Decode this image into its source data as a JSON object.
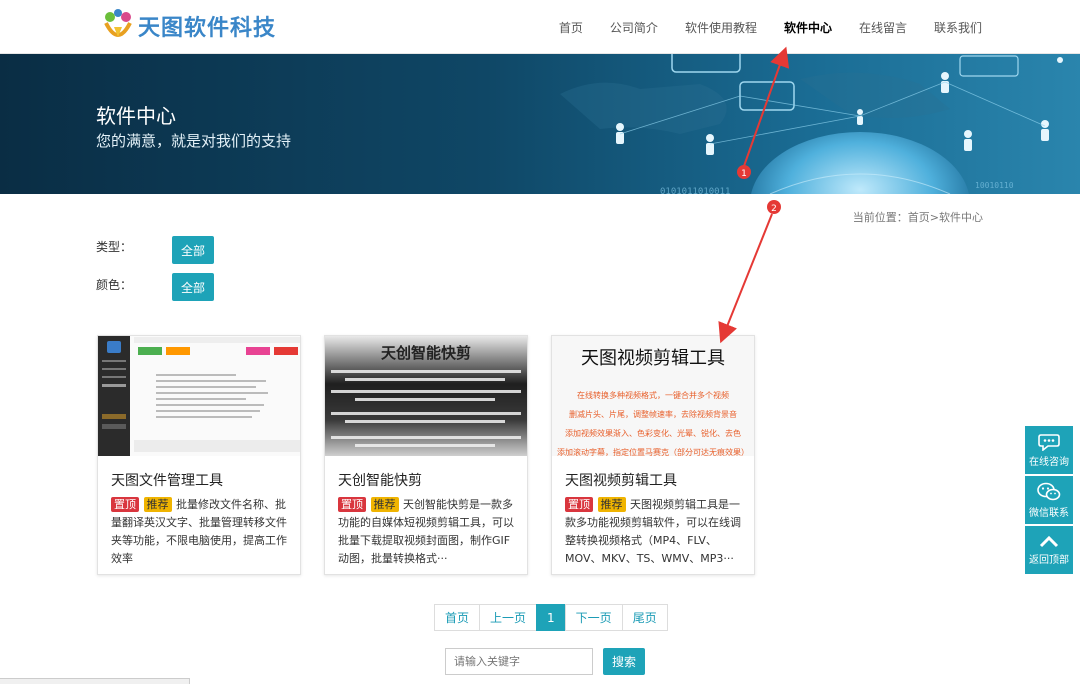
{
  "header": {
    "logo_text": "天图软件科技",
    "nav": [
      "首页",
      "公司简介",
      "软件使用教程",
      "软件中心",
      "在线留言",
      "联系我们"
    ],
    "active_index": 3
  },
  "banner": {
    "title": "软件中心",
    "subtitle": "您的满意，就是对我们的支持"
  },
  "breadcrumb": {
    "prefix": "当前位置：",
    "home": "首页",
    "sep": ">",
    "current": "软件中心"
  },
  "filters": [
    {
      "label": "类型：",
      "button": "全部"
    },
    {
      "label": "颜色：",
      "button": "全部"
    }
  ],
  "cards": [
    {
      "title": "天图文件管理工具",
      "tag_top": "置顶",
      "tag_rec": "推荐",
      "desc": "批量修改文件名称、批量翻译英汉文字、批量管理转移文件夹等功能，不限电脑使用，提高工作效率"
    },
    {
      "title": "天创智能快剪",
      "tag_top": "置顶",
      "tag_rec": "推荐",
      "desc": "天创智能快剪是一款多功能的自媒体短视频剪辑工具，可以批量下载提取视频封面图，制作GIF动图，批量转换格式···",
      "thumb_heading": "天创智能快剪"
    },
    {
      "title": "天图视频剪辑工具",
      "tag_top": "置顶",
      "tag_rec": "推荐",
      "desc": "天图视频剪辑工具是一款多功能视频剪辑软件，可以在线调整转换视频格式（MP4、FLV、MOV、MKV、TS、WMV、MP3···",
      "thumb_heading": "天图视频剪辑工具",
      "thumb_lines": [
        "在线转换多种视频格式，一键合并多个视频",
        "删减片头、片尾，调整帧速率，去除视频背景音",
        "添加视频效果渐入、色彩变化、光晕、锐化、去色",
        "添加滚动字幕，指定位置马赛克（部分可达无痕效果）"
      ]
    }
  ],
  "pagination": [
    "首页",
    "上一页",
    "1",
    "下一页",
    "尾页"
  ],
  "pagination_current": "1",
  "search": {
    "placeholder": "请输入关键字",
    "button": "搜索"
  },
  "side_float": [
    "在线咨询",
    "微信联系",
    "返回顶部"
  ],
  "annotations": [
    "1",
    "2"
  ],
  "colors": {
    "accent": "#1ea3b8",
    "annotation": "#e53935",
    "tag_top": "#d9363e",
    "tag_rec": "#f0b400"
  }
}
